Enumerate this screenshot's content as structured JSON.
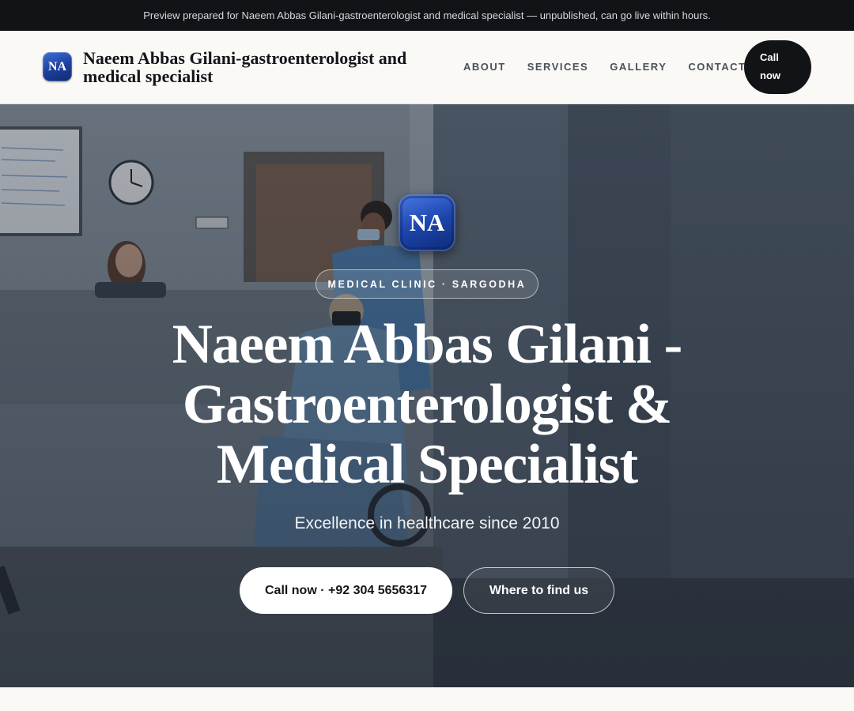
{
  "banner": {
    "text": "Preview prepared for Naeem Abbas Gilani-gastroenterologist and medical specialist — unpublished, can go live within hours."
  },
  "header": {
    "logo_initials": "NA",
    "brand_name": "Naeem Abbas Gilani-gastroenterologist and medical specialist",
    "nav": [
      {
        "label": "ABOUT"
      },
      {
        "label": "SERVICES"
      },
      {
        "label": "GALLERY"
      },
      {
        "label": "CONTACT"
      }
    ],
    "call_button": "Call now"
  },
  "hero": {
    "badge_initials": "NA",
    "pill_label": "MEDICAL CLINIC · SARGODHA",
    "title": "Naeem Abbas Gilani - Gastroenterologist & Medical Specialist",
    "subtitle": "Excellence in healthcare since 2010",
    "primary_button": "Call now · +92 304 5656317",
    "secondary_button": "Where to find us"
  },
  "colors": {
    "banner_bg": "#111317",
    "header_bg": "#faf9f6",
    "dark_button": "#111317",
    "logo_blue": "#1b3f9a"
  }
}
